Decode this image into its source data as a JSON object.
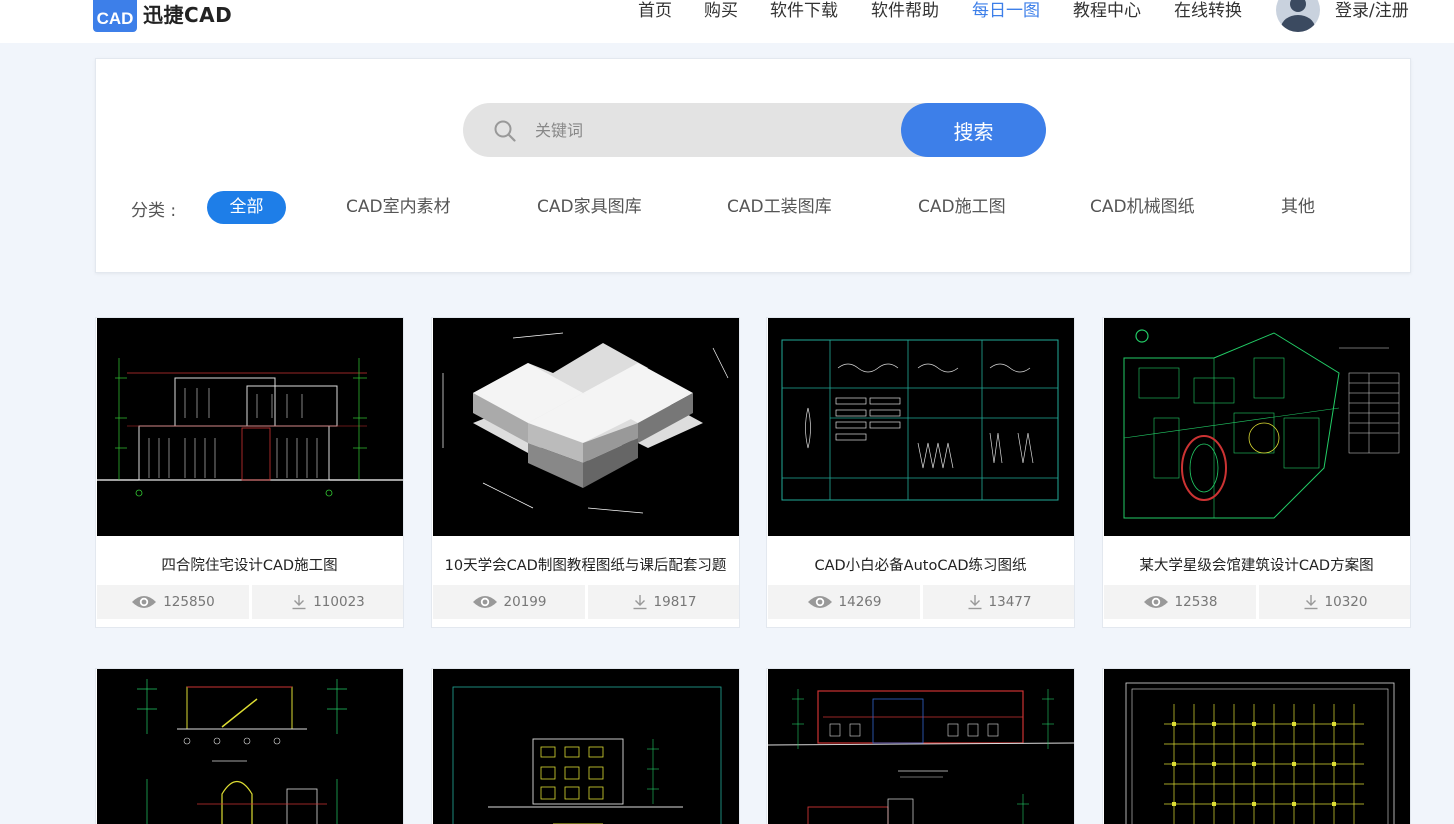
{
  "header": {
    "logo_mark": "CAD",
    "logo_text": "迅捷CAD",
    "nav": [
      {
        "label": "首页"
      },
      {
        "label": "购买"
      },
      {
        "label": "软件下载"
      },
      {
        "label": "软件帮助"
      },
      {
        "label": "每日一图"
      },
      {
        "label": "教程中心"
      },
      {
        "label": "在线转换"
      }
    ],
    "active_nav": "每日一图",
    "login_label": "登录/注册"
  },
  "search": {
    "placeholder": "关键词",
    "button_label": "搜索"
  },
  "categories": {
    "label": "分类 :",
    "items": [
      "全部",
      "CAD室内素材",
      "CAD家具图库",
      "CAD工装图库",
      "CAD施工图",
      "CAD机械图纸",
      "其他"
    ],
    "active": "全部"
  },
  "cards": [
    {
      "title": "四合院住宅设计CAD施工图",
      "views": "125850",
      "downloads": "110023"
    },
    {
      "title": "10天学会CAD制图教程图纸与课后配套习题",
      "views": "20199",
      "downloads": "19817"
    },
    {
      "title": "CAD小白必备AutoCAD练习图纸",
      "views": "14269",
      "downloads": "13477"
    },
    {
      "title": "某大学星级会馆建筑设计CAD方案图",
      "views": "12538",
      "downloads": "10320"
    }
  ],
  "colors": {
    "accent": "#3d7fe9",
    "active_category": "#1e7ee8",
    "page_bg": "#f1f5fb"
  }
}
